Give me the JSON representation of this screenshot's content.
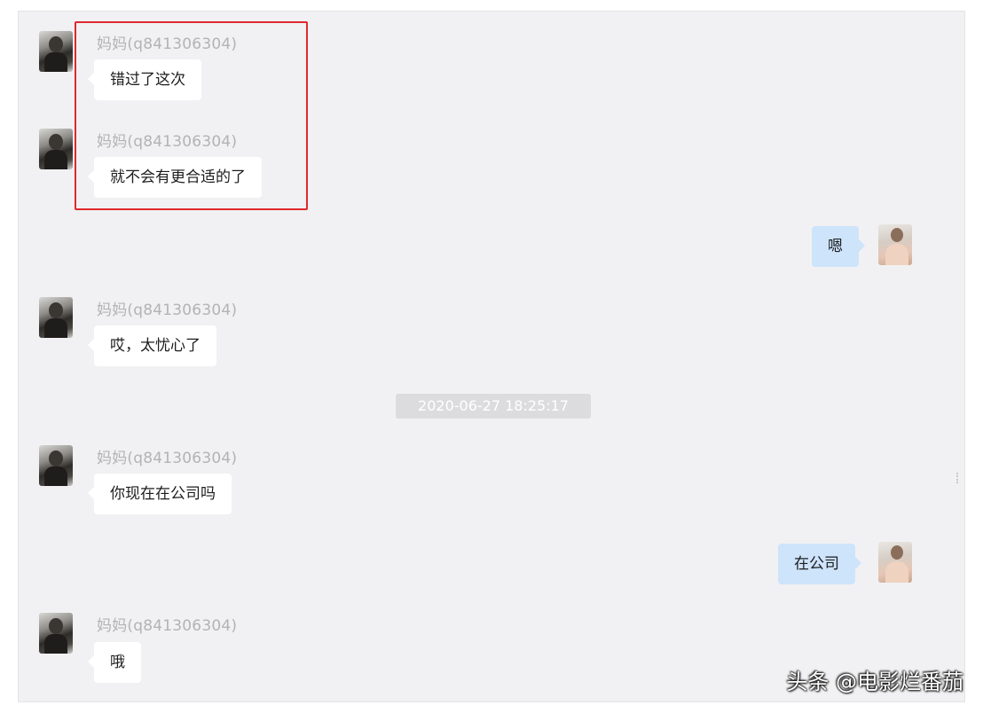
{
  "contact_name": "妈妈(q841306304)",
  "messages": [
    {
      "side": "in",
      "sender": "妈妈(q841306304)",
      "text": "错过了这次"
    },
    {
      "side": "in",
      "sender": "妈妈(q841306304)",
      "text": "就不会有更合适的了"
    },
    {
      "side": "out",
      "text": "嗯"
    },
    {
      "side": "in",
      "sender": "妈妈(q841306304)",
      "text": "哎，太忧心了"
    },
    {
      "side": "in",
      "sender": "妈妈(q841306304)",
      "text": "你现在在公司吗"
    },
    {
      "side": "out",
      "text": "在公司"
    },
    {
      "side": "in",
      "sender": "妈妈(q841306304)",
      "text": "哦"
    }
  ],
  "timestamp": "2020-06-27 18:25:17",
  "watermark": "头条 @电影烂番茄",
  "colors": {
    "incoming_bubble": "#ffffff",
    "outgoing_bubble": "#cde4fb",
    "highlight": "#e0282e",
    "background": "#f1f1f3"
  }
}
